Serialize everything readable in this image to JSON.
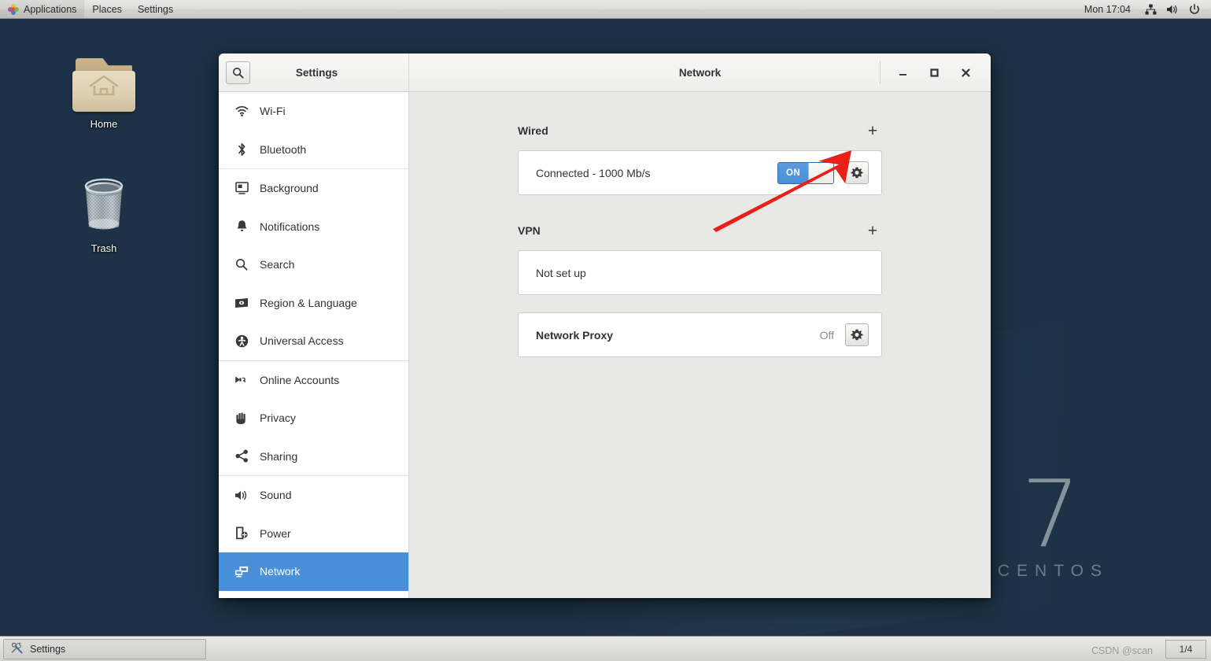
{
  "top_panel": {
    "applications": "Applications",
    "places": "Places",
    "settings": "Settings",
    "clock": "Mon 17:04",
    "icons": [
      "network-wired-icon",
      "volume-icon",
      "power-icon"
    ]
  },
  "desktop": {
    "icons": [
      {
        "name": "home-folder-icon",
        "label": "Home"
      },
      {
        "name": "trash-icon",
        "label": "Trash"
      }
    ],
    "branding": {
      "version": "7",
      "name": "CENTOS"
    }
  },
  "window": {
    "left_title": "Settings",
    "right_title": "Network",
    "search_icon": "search-icon",
    "controls": {
      "minimize": "–",
      "maximize": "□",
      "close": "✕"
    }
  },
  "sidebar": {
    "groups": [
      {
        "items": [
          {
            "label": "Wi-Fi",
            "icon": "wifi-icon",
            "selected": false
          },
          {
            "label": "Bluetooth",
            "icon": "bluetooth-icon",
            "selected": false
          }
        ]
      },
      {
        "items": [
          {
            "label": "Background",
            "icon": "background-icon",
            "selected": false
          },
          {
            "label": "Notifications",
            "icon": "bell-icon",
            "selected": false
          },
          {
            "label": "Search",
            "icon": "search-icon",
            "selected": false
          },
          {
            "label": "Region & Language",
            "icon": "keyboard-icon",
            "selected": false
          },
          {
            "label": "Universal Access",
            "icon": "accessibility-icon",
            "selected": false
          }
        ]
      },
      {
        "items": [
          {
            "label": "Online Accounts",
            "icon": "online-accounts-icon",
            "selected": false
          },
          {
            "label": "Privacy",
            "icon": "hand-icon",
            "selected": false
          },
          {
            "label": "Sharing",
            "icon": "share-icon",
            "selected": false
          }
        ]
      },
      {
        "items": [
          {
            "label": "Sound",
            "icon": "speaker-icon",
            "selected": false
          },
          {
            "label": "Power",
            "icon": "power-plug-icon",
            "selected": false
          },
          {
            "label": "Network",
            "icon": "network-icon",
            "selected": true
          }
        ]
      }
    ]
  },
  "network_panel": {
    "wired": {
      "title": "Wired",
      "add_label": "+",
      "status": "Connected - 1000 Mb/s",
      "toggle_state": "ON",
      "settings_icon": "gear-icon"
    },
    "vpn": {
      "title": "VPN",
      "add_label": "+",
      "status": "Not set up"
    },
    "proxy": {
      "title": "Network Proxy",
      "status": "Off",
      "settings_icon": "gear-icon"
    }
  },
  "annotation": {
    "arrow_color": "#e8201a",
    "points_to": "wired-settings-gear-button"
  },
  "taskbar": {
    "window_button": "Settings",
    "window_icon": "tools-icon",
    "workspace": "1/4"
  },
  "watermark": {
    "text": "CSDN @scan"
  },
  "colors": {
    "accent_blue": "#4a90d9",
    "panel_bg": "#e8e8e6",
    "desktop_bg": "#1d3246",
    "arrow_red": "#e8201a"
  }
}
